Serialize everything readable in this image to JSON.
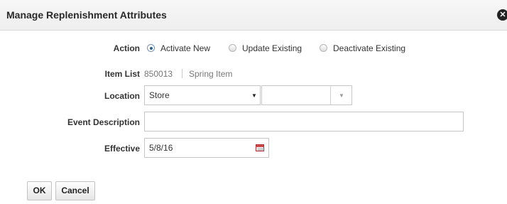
{
  "dialog": {
    "title": "Manage Replenishment Attributes"
  },
  "action": {
    "label": "Action",
    "options": [
      {
        "label": "Activate New",
        "selected": true
      },
      {
        "label": "Update Existing",
        "selected": false
      },
      {
        "label": "Deactivate Existing",
        "selected": false
      }
    ]
  },
  "item_list": {
    "label": "Item List",
    "id": "850013",
    "name": "Spring Item"
  },
  "location": {
    "label": "Location",
    "type_value": "Store",
    "value": ""
  },
  "event_description": {
    "label": "Event Description",
    "value": ""
  },
  "effective": {
    "label": "Effective",
    "value": "5/8/16"
  },
  "buttons": {
    "ok": "OK",
    "cancel": "Cancel"
  },
  "colors": {
    "radio_selected": "#2e5d8a",
    "calendar_icon": "#c94b4b"
  }
}
